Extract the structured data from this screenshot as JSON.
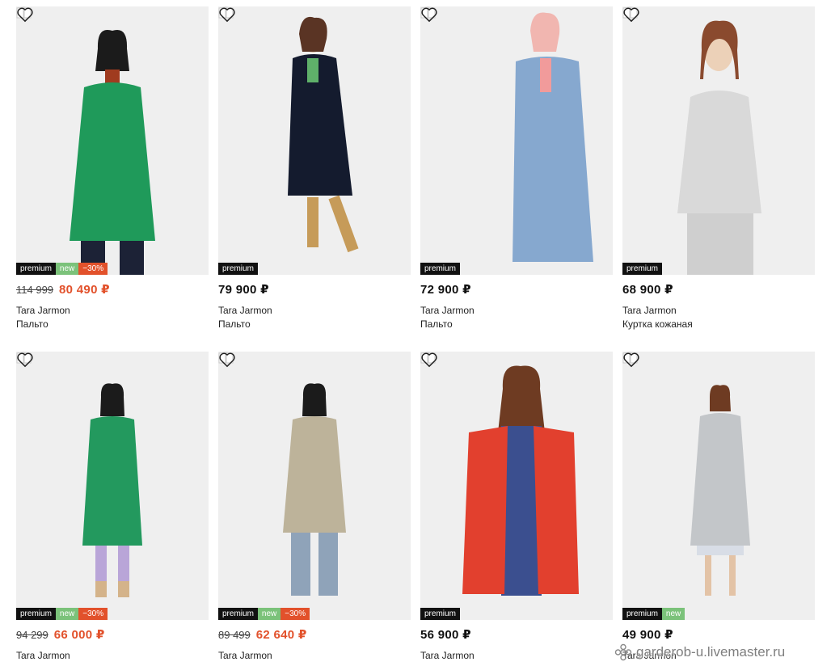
{
  "icons": {
    "compare": "book-compare-icon",
    "wishlist": "heart-icon"
  },
  "colors": {
    "sale_price": "#e2512b",
    "badge_premium": "#111111",
    "badge_new": "#7bc27a",
    "badge_sale": "#e2512b"
  },
  "products": [
    {
      "badges": {
        "premium": "premium",
        "new": "new",
        "sale": "−30%"
      },
      "old_price": "114 999",
      "price": "80 490 ₽",
      "brand": "Tara Jarmon",
      "type": "Пальто",
      "garment_color": "#1f9a5a"
    },
    {
      "badges": {
        "premium": "premium"
      },
      "price": "79 900 ₽",
      "brand": "Tara Jarmon",
      "type": "Пальто",
      "garment_color": "#141b2e"
    },
    {
      "badges": {
        "premium": "premium"
      },
      "price": "72 900 ₽",
      "brand": "Tara Jarmon",
      "type": "Пальто",
      "garment_color": "#86a8cf"
    },
    {
      "badges": {
        "premium": "premium"
      },
      "price": "68 900 ₽",
      "brand": "Tara Jarmon",
      "type": "Куртка кожаная",
      "garment_color": "#d9d9d9"
    },
    {
      "badges": {
        "premium": "premium",
        "new": "new",
        "sale": "−30%"
      },
      "old_price": "94 299",
      "price": "66 000 ₽",
      "brand": "Tara Jarmon",
      "garment_color": "#23995e"
    },
    {
      "badges": {
        "premium": "premium",
        "new": "new",
        "sale": "−30%"
      },
      "old_price": "89 499",
      "price": "62 640 ₽",
      "brand": "Tara Jarmon",
      "garment_color": "#bdb39a"
    },
    {
      "badges": {
        "premium": "premium"
      },
      "price": "56 900 ₽",
      "brand": "Tara Jarmon",
      "garment_color": "#e2402e"
    },
    {
      "badges": {
        "premium": "premium",
        "new": "new"
      },
      "price": "49 900 ₽",
      "brand": "Tara Jarmon",
      "garment_color": "#c3c6c9"
    }
  ],
  "watermark": {
    "text": "garderob-u.livemaster.ru",
    "icon": "flower-logo-icon"
  }
}
